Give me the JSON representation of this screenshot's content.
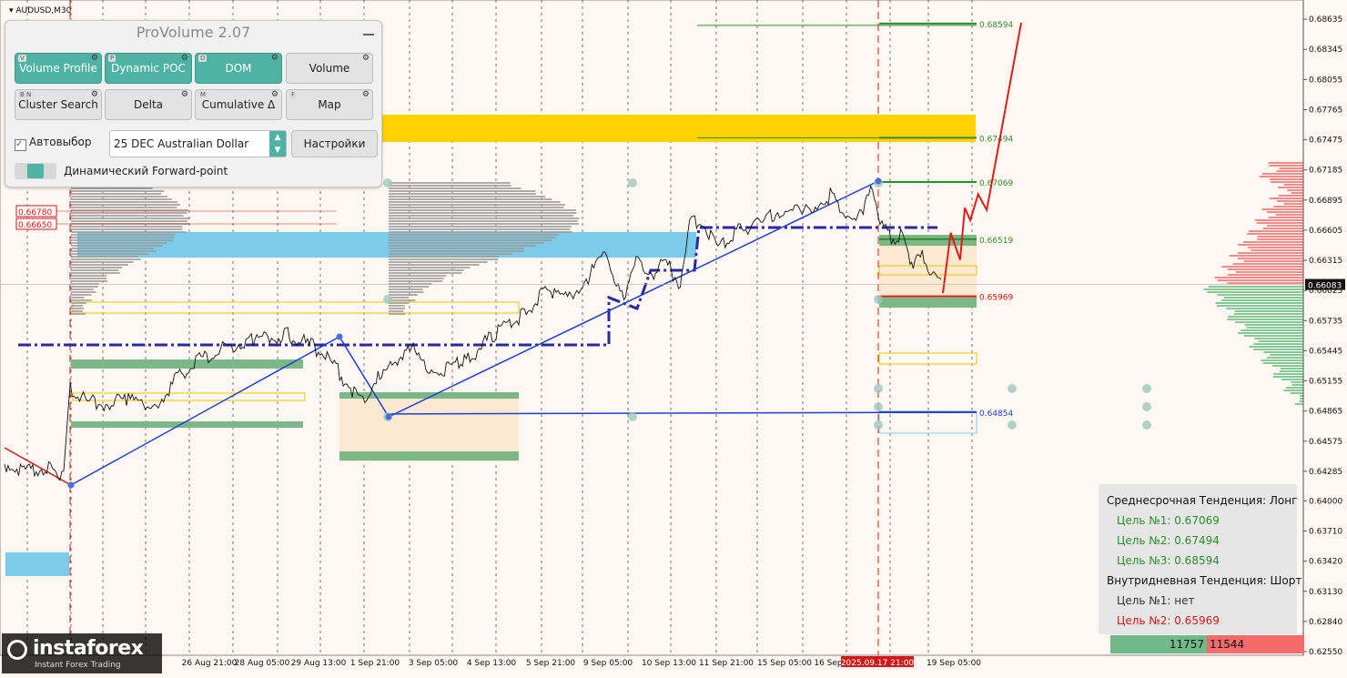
{
  "window": {
    "symbol_label": "AUDUSD,M30"
  },
  "colors": {
    "background": "#fff7f1",
    "price_line": "#111111",
    "trend_line": "#1f3fd0",
    "poc_dash": "#2a2aa0",
    "target_green": "#2e8b2e",
    "target_red": "#d01818",
    "zone_yellow": "#ffd200",
    "zone_blue": "#7ccbea",
    "zone_green": "#7cb887",
    "forecast": "#dd1c1c"
  },
  "panel": {
    "title": "ProVolume 2.07",
    "buttons": [
      {
        "key": "V",
        "label": "Volume Profile",
        "on": true
      },
      {
        "key": "P",
        "label": "Dynamic POC",
        "on": true
      },
      {
        "key": "D",
        "label": "DOM",
        "on": true
      },
      {
        "key": "",
        "label": "Volume",
        "on": false
      },
      {
        "key": "B  N",
        "label": "Cluster Search",
        "on": false
      },
      {
        "key": "",
        "label": "Delta",
        "on": false
      },
      {
        "key": "M",
        "label": "Cumulative Δ",
        "on": false
      },
      {
        "key": "F",
        "label": "Map",
        "on": false
      }
    ],
    "auto_label": "Автовыбор",
    "instrument": "25 DEC Australian Dollar",
    "settings_label": "Настройки",
    "forward_point_label": "Динамический Forward-point"
  },
  "trend": {
    "mid_title": "Среднесрочная Тенденция: Лонг",
    "mid_targets": [
      "Цель №1: 0.67069",
      "Цель №2: 0.67494",
      "Цель №3: 0.68594"
    ],
    "intra_title": "Внутридневная Тенденция: Шорт",
    "intra_targets": [
      {
        "text": "Цель №1: нет",
        "color": "#333333"
      },
      {
        "text": "Цель №2: 0.65969",
        "color": "#d01818"
      }
    ]
  },
  "volume_bar": {
    "buy": "11757",
    "sell": "11544"
  },
  "brand": {
    "name": "instaforex",
    "tagline": "Instant Forex Trading"
  },
  "chart_data": {
    "type": "line",
    "title": "AUDUSD,M30",
    "ylim": [
      0.6255,
      0.6875
    ],
    "y_ticks": [
      "0.68635",
      "0.68345",
      "0.68055",
      "0.67765",
      "0.67475",
      "0.67185",
      "0.66895",
      "0.66605",
      "0.66315",
      "0.66025",
      "0.65735",
      "0.65445",
      "0.65155",
      "0.64865",
      "0.64575",
      "0.64285",
      "0.64000",
      "0.63710",
      "0.63420",
      "0.63130",
      "0.62840",
      "0.62550"
    ],
    "x_ticks": [
      "26 Aug 21:00",
      "28 Aug 05:00",
      "29 Aug 13:00",
      "1 Sep 21:00",
      "3 Sep 05:00",
      "4 Sep 13:00",
      "5 Sep 21:00",
      "9 Sep 05:00",
      "10 Sep 13:00",
      "11 Sep 21:00",
      "15 Sep 05:00",
      "16 Sep",
      "2025.09.17 21:00",
      "19 Sep 05:00"
    ],
    "current_price": "0.66083",
    "price_series": {
      "name": "AUDUSD",
      "x": [
        0,
        0.015,
        0.03,
        0.045,
        0.055,
        0.063,
        0.07,
        0.08,
        0.1,
        0.13,
        0.16,
        0.2,
        0.24,
        0.265,
        0.3,
        0.34,
        0.38,
        0.4,
        0.415,
        0.43,
        0.445,
        0.465,
        0.49,
        0.52,
        0.55,
        0.58,
        0.6,
        0.62,
        0.64,
        0.66,
        0.675,
        0.69,
        0.705,
        0.72,
        0.73,
        0.745,
        0.76,
        0.77,
        0.78,
        0.79,
        0.81,
        0.83,
        0.85,
        0.87,
        0.88,
        0.9,
        0.915,
        0.925,
        0.935,
        0.945,
        0.955,
        0.965,
        0.97,
        0.98,
        0.99,
        1.0
      ],
      "values": [
        0.6432,
        0.6428,
        0.6425,
        0.6428,
        0.6421,
        0.6426,
        0.6505,
        0.6495,
        0.6489,
        0.6495,
        0.6489,
        0.653,
        0.6545,
        0.6552,
        0.6557,
        0.654,
        0.6492,
        0.652,
        0.6526,
        0.6548,
        0.653,
        0.652,
        0.653,
        0.6555,
        0.6575,
        0.66,
        0.659,
        0.661,
        0.6632,
        0.6595,
        0.663,
        0.6615,
        0.6625,
        0.6605,
        0.6665,
        0.6663,
        0.664,
        0.665,
        0.6655,
        0.666,
        0.6665,
        0.6678,
        0.6672,
        0.6685,
        0.669,
        0.667,
        0.6672,
        0.6703,
        0.666,
        0.6648,
        0.6652,
        0.6628,
        0.6625,
        0.6632,
        0.6612,
        0.6608
      ]
    },
    "levels": [
      {
        "label": "0.68594",
        "value": 0.68594,
        "color": "#2e8b2e"
      },
      {
        "label": "0.67494",
        "value": 0.67494,
        "color": "#2e8b2e"
      },
      {
        "label": "0.67069",
        "value": 0.67069,
        "color": "#2e8b2e"
      },
      {
        "label": "0.66519",
        "value": 0.66519,
        "color": "#2e8b2e"
      },
      {
        "label": "0.65969",
        "value": 0.65969,
        "color": "#d01818"
      },
      {
        "label": "0.64854",
        "value": 0.64854,
        "color": "#1f3fd0"
      }
    ],
    "left_labels": [
      "0.66780",
      "0.66650"
    ],
    "forecast": {
      "x": [
        0.0,
        0.1,
        0.22,
        0.28,
        0.35,
        0.45,
        0.56,
        1.0
      ],
      "values": [
        0.66,
        0.6658,
        0.6632,
        0.6682,
        0.667,
        0.6695,
        0.668,
        0.686
      ]
    }
  }
}
